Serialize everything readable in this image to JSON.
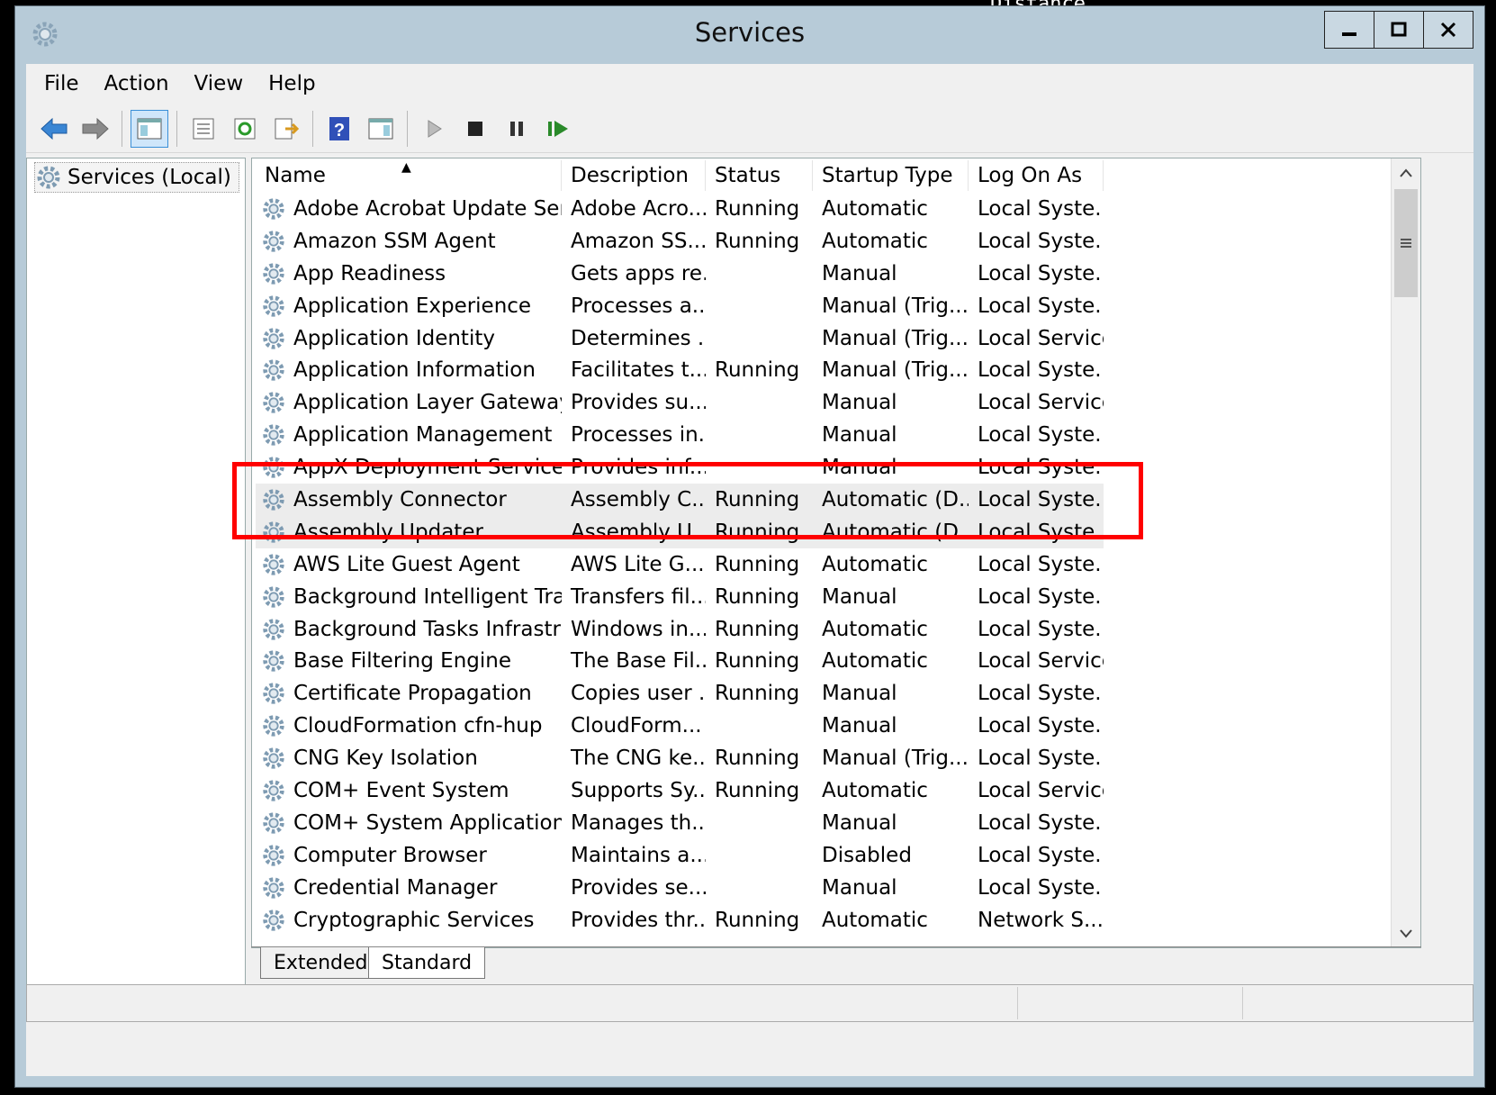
{
  "window": {
    "title": "Services"
  },
  "menu": [
    "File",
    "Action",
    "View",
    "Help"
  ],
  "tree": {
    "root_label": "Services (Local)"
  },
  "columns": [
    "Name",
    "Description",
    "Status",
    "Startup Type",
    "Log On As"
  ],
  "services": [
    {
      "name": "Adobe Acrobat Update Serv...",
      "description": "Adobe Acro...",
      "status": "Running",
      "startup": "Automatic",
      "logon": "Local Syste..."
    },
    {
      "name": "Amazon SSM Agent",
      "description": "Amazon SS...",
      "status": "Running",
      "startup": "Automatic",
      "logon": "Local Syste..."
    },
    {
      "name": "App Readiness",
      "description": "Gets apps re...",
      "status": "",
      "startup": "Manual",
      "logon": "Local Syste..."
    },
    {
      "name": "Application Experience",
      "description": "Processes a...",
      "status": "",
      "startup": "Manual (Trig...",
      "logon": "Local Syste..."
    },
    {
      "name": "Application Identity",
      "description": "Determines ...",
      "status": "",
      "startup": "Manual (Trig...",
      "logon": "Local Service"
    },
    {
      "name": "Application Information",
      "description": "Facilitates t...",
      "status": "Running",
      "startup": "Manual (Trig...",
      "logon": "Local Syste..."
    },
    {
      "name": "Application Layer Gateway ...",
      "description": "Provides su...",
      "status": "",
      "startup": "Manual",
      "logon": "Local Service"
    },
    {
      "name": "Application Management",
      "description": "Processes in...",
      "status": "",
      "startup": "Manual",
      "logon": "Local Syste..."
    },
    {
      "name": "AppX Deployment Service (...",
      "description": "Provides inf...",
      "status": "",
      "startup": "Manual",
      "logon": "Local Syste..."
    },
    {
      "name": "Assembly Connector",
      "description": "Assembly C...",
      "status": "Running",
      "startup": "Automatic (D...",
      "logon": "Local Syste..."
    },
    {
      "name": "Assembly Updater",
      "description": "Assembly U...",
      "status": "Running",
      "startup": "Automatic (D...",
      "logon": "Local Syste..."
    },
    {
      "name": "AWS Lite Guest Agent",
      "description": "AWS Lite G...",
      "status": "Running",
      "startup": "Automatic",
      "logon": "Local Syste..."
    },
    {
      "name": "Background Intelligent Tran...",
      "description": "Transfers fil...",
      "status": "Running",
      "startup": "Manual",
      "logon": "Local Syste..."
    },
    {
      "name": "Background Tasks Infrastru...",
      "description": "Windows in...",
      "status": "Running",
      "startup": "Automatic",
      "logon": "Local Syste..."
    },
    {
      "name": "Base Filtering Engine",
      "description": "The Base Fil...",
      "status": "Running",
      "startup": "Automatic",
      "logon": "Local Service"
    },
    {
      "name": "Certificate Propagation",
      "description": "Copies user ...",
      "status": "Running",
      "startup": "Manual",
      "logon": "Local Syste..."
    },
    {
      "name": "CloudFormation cfn-hup",
      "description": "CloudForm...",
      "status": "",
      "startup": "Manual",
      "logon": "Local Syste..."
    },
    {
      "name": "CNG Key Isolation",
      "description": "The CNG ke...",
      "status": "Running",
      "startup": "Manual (Trig...",
      "logon": "Local Syste..."
    },
    {
      "name": "COM+ Event System",
      "description": "Supports Sy...",
      "status": "Running",
      "startup": "Automatic",
      "logon": "Local Service"
    },
    {
      "name": "COM+ System Application",
      "description": "Manages th...",
      "status": "",
      "startup": "Manual",
      "logon": "Local Syste..."
    },
    {
      "name": "Computer Browser",
      "description": "Maintains a...",
      "status": "",
      "startup": "Disabled",
      "logon": "Local Syste..."
    },
    {
      "name": "Credential Manager",
      "description": "Provides se...",
      "status": "",
      "startup": "Manual",
      "logon": "Local Syste..."
    },
    {
      "name": "Cryptographic Services",
      "description": "Provides thr...",
      "status": "Running",
      "startup": "Automatic",
      "logon": "Network S..."
    }
  ],
  "highlighted_rows": [
    "Assembly Connector",
    "Assembly Updater"
  ],
  "tabs": [
    "Extended",
    "Standard"
  ],
  "active_tab": "Standard",
  "colors": {
    "highlight_box": "#ff0000",
    "titlebar": "#b7cbd8"
  }
}
